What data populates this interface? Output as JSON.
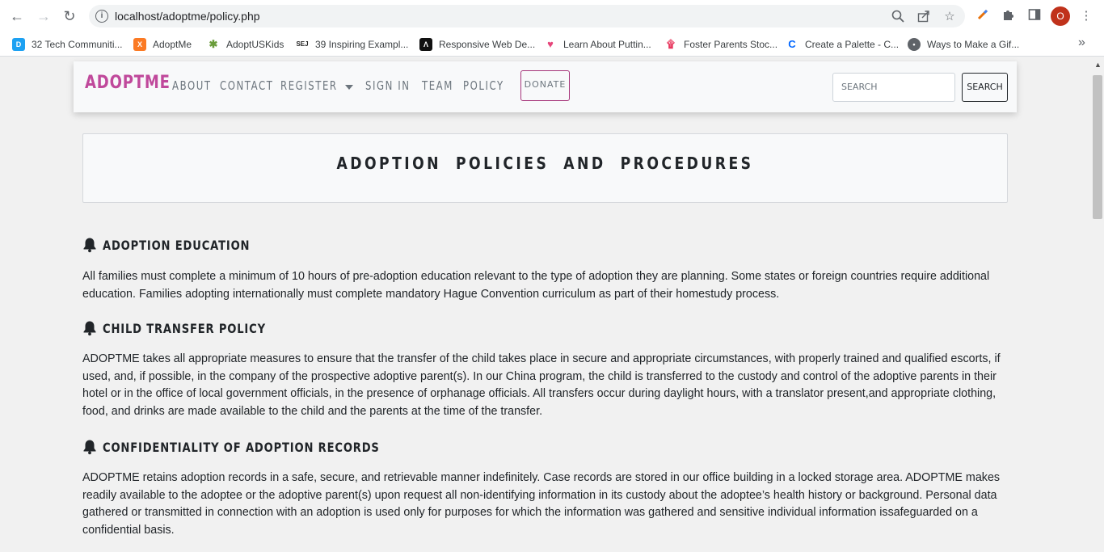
{
  "browser": {
    "url": "localhost/adoptme/policy.php",
    "profile_initial": "O",
    "bookmarks": [
      {
        "label": "32 Tech Communiti...",
        "icon": "tech-favicon",
        "color": "#1da1f2"
      },
      {
        "label": "AdoptMe",
        "icon": "xampp-favicon",
        "color": "#fb7a24"
      },
      {
        "label": "AdoptUSKids",
        "icon": "adoptuskids-favicon",
        "color": "#6a9c3a"
      },
      {
        "label": "39 Inspiring Exampl...",
        "icon": "sej-favicon",
        "color": "#222222"
      },
      {
        "label": "Responsive Web De...",
        "icon": "webdesign-favicon",
        "color": "#111111"
      },
      {
        "label": "Learn About Puttin...",
        "icon": "heart-favicon",
        "color": "#e6457a"
      },
      {
        "label": "Foster Parents Stoc...",
        "icon": "spiral-favicon",
        "color": "#e8365d"
      },
      {
        "label": "Create a Palette - C...",
        "icon": "coolors-favicon",
        "color": "#0066ff"
      },
      {
        "label": "Ways to Make a Gif...",
        "icon": "globe-favicon",
        "color": "#5f6368"
      }
    ]
  },
  "navbar": {
    "brand": "ADOPTME",
    "links": [
      "ABOUT",
      "CONTACT",
      "REGISTER",
      "SIGN IN",
      "TEAM",
      "POLICY"
    ],
    "donate": "DONATE",
    "search_placeholder": "SEARCH",
    "search_button": "SEARCH"
  },
  "page": {
    "title": "ADOPTION POLICIES AND PROCEDURES",
    "sections": [
      {
        "heading": "ADOPTION EDUCATION",
        "lines": [
          "All families must complete a minimum of 10 hours of pre-adoption education relevant to the type of adoption they are planning. Some states or foreign countries require additional",
          "education. Families adopting internationally must complete mandatory Hague Convention curriculum as part of their homestudy process."
        ]
      },
      {
        "heading": "CHILD TRANSFER POLICY",
        "lines": [
          "ADOPTME takes all appropriate measures to ensure that the transfer of the child takes place in secure and appropriate circumstances, with properly trained and qualified escorts, if",
          "used, and, if possible, in the company of the prospective adoptive parent(s). In our China program, the child is transferred to the custody and control of the adoptive parents in their",
          "hotel or in the office of local government officials, in the presence of orphanage officials. All transfers occur during daylight hours, with a translator present,and appropriate clothing,",
          "food, and drinks are made available to the child and the parents at the time of the transfer."
        ]
      },
      {
        "heading": "CONFIDENTIALITY OF ADOPTION RECORDS",
        "lines": [
          "ADOPTME retains adoption records in a safe, secure, and retrievable manner indefinitely. Case records are stored in our office building in a locked storage area. ADOPTME makes",
          "readily available to the adoptee or the adoptive parent(s) upon request all non-identifying information in its custody about the adoptee’s health history or background. Personal data",
          "gathered or transmitted in connection with an adoption is used only for purposes for which the information was gathered and sensitive individual information issafeguarded on a",
          "confidential basis."
        ]
      }
    ]
  }
}
